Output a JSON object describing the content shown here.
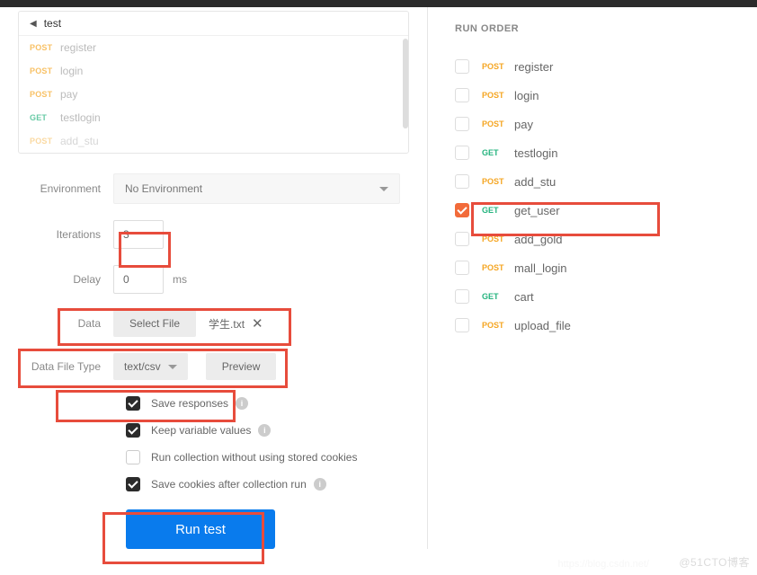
{
  "collection": {
    "name": "test",
    "requests": [
      {
        "method": "POST",
        "method_class": "post",
        "name": "register"
      },
      {
        "method": "POST",
        "method_class": "post",
        "name": "login"
      },
      {
        "method": "POST",
        "method_class": "post",
        "name": "pay"
      },
      {
        "method": "GET",
        "method_class": "get",
        "name": "testlogin"
      },
      {
        "method": "POST",
        "method_class": "post",
        "name": "add_stu"
      }
    ]
  },
  "settings": {
    "environment_label": "Environment",
    "environment_value": "No Environment",
    "iterations_label": "Iterations",
    "iterations_value": "3",
    "delay_label": "Delay",
    "delay_value": "0",
    "delay_unit": "ms",
    "data_label": "Data",
    "select_file_btn": "Select File",
    "data_file_name": "学生.txt",
    "data_file_type_label": "Data File Type",
    "data_file_type_value": "text/csv",
    "preview_btn": "Preview",
    "save_responses": "Save responses",
    "keep_variable": "Keep variable values",
    "run_without_cookies": "Run collection without using stored cookies",
    "save_cookies": "Save cookies after collection run",
    "run_btn": "Run test"
  },
  "run_order": {
    "title": "RUN ORDER",
    "items": [
      {
        "method": "POST",
        "method_class": "post",
        "name": "register",
        "checked": false
      },
      {
        "method": "POST",
        "method_class": "post",
        "name": "login",
        "checked": false
      },
      {
        "method": "POST",
        "method_class": "post",
        "name": "pay",
        "checked": false
      },
      {
        "method": "GET",
        "method_class": "get",
        "name": "testlogin",
        "checked": false
      },
      {
        "method": "POST",
        "method_class": "post",
        "name": "add_stu",
        "checked": false
      },
      {
        "method": "GET",
        "method_class": "get",
        "name": "get_user",
        "checked": true
      },
      {
        "method": "POST",
        "method_class": "post",
        "name": "add_gold",
        "checked": false
      },
      {
        "method": "POST",
        "method_class": "post",
        "name": "mall_login",
        "checked": false
      },
      {
        "method": "GET",
        "method_class": "get",
        "name": "cart",
        "checked": false
      },
      {
        "method": "POST",
        "method_class": "post",
        "name": "upload_file",
        "checked": false
      }
    ]
  },
  "watermark": "@51CTO博客",
  "watermark2": "https://blog.csdn.net/"
}
